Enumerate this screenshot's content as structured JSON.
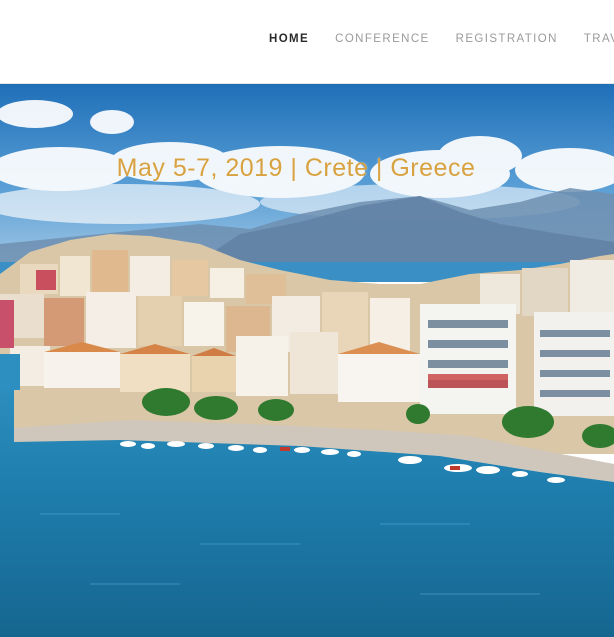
{
  "nav": {
    "items": [
      {
        "label": "HOME",
        "active": true
      },
      {
        "label": "CONFERENCE",
        "active": false
      },
      {
        "label": "REGISTRATION",
        "active": false
      },
      {
        "label": "TRAVEL",
        "active": false
      }
    ]
  },
  "hero": {
    "tagline": "May 5-7, 2019 | Crete | Greece",
    "image": "harbor-town-photo"
  },
  "colors": {
    "nav_active": "#2b2b2b",
    "nav_inactive": "#9a9a9a",
    "tagline": "#d8a241",
    "sky": "#2f7fc4",
    "sea": "#1d7fae"
  }
}
